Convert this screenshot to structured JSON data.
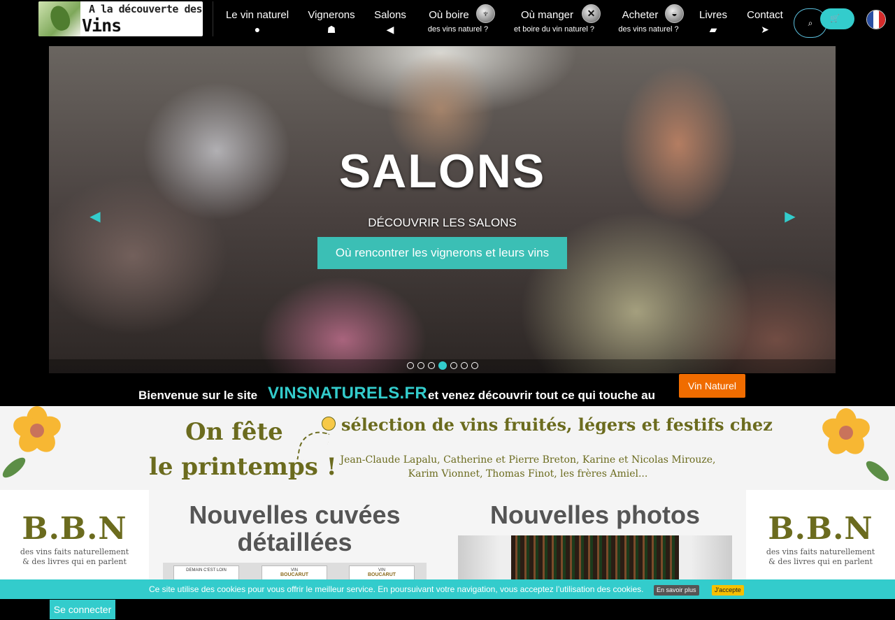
{
  "header": {
    "logo": {
      "line1": "A la découverte des",
      "line2": "Vins Naturels"
    },
    "nav": [
      {
        "label": "Le vin naturel",
        "icon": "info-circle-icon",
        "glyph": "ℹ"
      },
      {
        "label": "Vignerons",
        "icon": "users-icon",
        "glyph": "👥"
      },
      {
        "label": "Salons",
        "icon": "bullhorn-icon",
        "glyph": "📢"
      },
      {
        "label": "Où boire",
        "sub": "des vins naturel ?",
        "icon": "wine-glass-icon"
      },
      {
        "label": "Où manger",
        "sub": "et boire du vin naturel ?",
        "icon": "cutlery-icon"
      },
      {
        "label": "Acheter",
        "sub": "des vins naturel ?",
        "icon": "basket-icon"
      },
      {
        "label": "Livres",
        "icon": "book-icon",
        "glyph": "📖"
      },
      {
        "label": "Contact",
        "icon": "paper-plane-icon",
        "glyph": "✈"
      }
    ],
    "search_icon": "search-icon",
    "cart_icon": "shopping-cart-icon",
    "language": "fr",
    "accent_color": "#33cccc"
  },
  "carousel": {
    "title": "SALONS",
    "subtitle": "DÉCOUVRIR LES SALONS",
    "button_label": "Où rencontrer les vignerons et leurs vins",
    "slide_count": 7,
    "active_slide": 4
  },
  "welcome": {
    "text_before": "Bienvenue sur le site",
    "site_name": "VINSNATURELS.FR",
    "text_after": "et venez découvrir tout ce qui touche au",
    "button_label": "Vin Naturel",
    "button_color": "#f06c00"
  },
  "banner": {
    "left_line1": "On fête",
    "left_line2": "le printemps !",
    "headline": "sélection de vins fruités, légers et festifs chez",
    "names": "Jean-Claude Lapalu, Catherine et Pierre Breton, Karine et Nicolas Mirouze, Karim Vionnet, Thomas Finot, les frères Amiel..."
  },
  "side_ads": {
    "title": "B.B.N",
    "line1": "des vins faits naturellement",
    "line2": "& des livres qui en parlent"
  },
  "main": {
    "cuvees_title": "Nouvelles cuvées détaillées",
    "photos_title": "Nouvelles photos",
    "cards": [
      {
        "title": "DEMAIN C'EST LOIN",
        "brand": ""
      },
      {
        "title": "VIN",
        "brand": "BOUCARUT"
      },
      {
        "title": "VIN",
        "brand": "BOUCARUT"
      }
    ]
  },
  "cookie": {
    "text": "Ce site utilise des cookies pour vous offrir le meilleur service. En poursuivant votre navigation, vous acceptez l’utilisation des cookies.",
    "more_label": "En savoir plus",
    "accept_label": "J'accepte"
  },
  "footer": {
    "login_label": "Se connecter"
  }
}
